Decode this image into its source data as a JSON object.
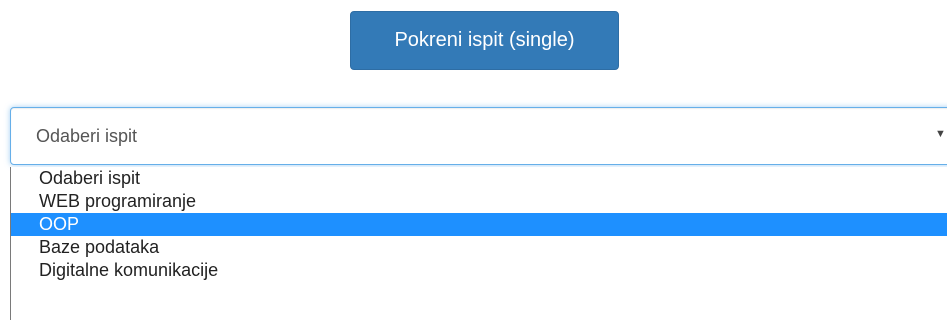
{
  "actions": {
    "start_button_label": "Pokreni ispit (single)"
  },
  "exam_select": {
    "selected_value": "Odaberi ispit",
    "arrow_icon": "▼",
    "highlighted_index": 2,
    "options": [
      "Odaberi ispit",
      "WEB programiranje",
      "OOP",
      "Baze podataka",
      "Digitalne komunikacije"
    ]
  },
  "colors": {
    "button_bg": "#337ab7",
    "highlight_bg": "#1e90ff",
    "focus_border": "#66afe9"
  }
}
